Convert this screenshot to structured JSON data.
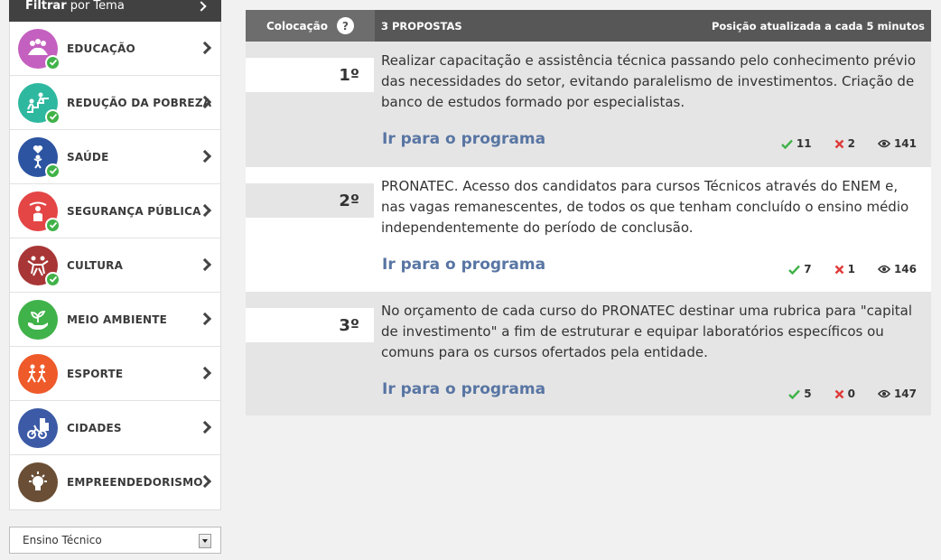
{
  "filter": {
    "title": "Filtrar",
    "subtitle": "por Tema"
  },
  "sidebar": {
    "items": [
      {
        "label": "EDUCAÇÃO",
        "color": "#c460bf",
        "checked": true
      },
      {
        "label": "REDUÇÃO DA POBREZA",
        "color": "#2fb8a0",
        "checked": true
      },
      {
        "label": "SAÚDE",
        "color": "#2c54a1",
        "checked": true
      },
      {
        "label": "SEGURANÇA PÚBLICA",
        "color": "#e44545",
        "checked": true
      },
      {
        "label": "CULTURA",
        "color": "#a83636",
        "checked": true
      },
      {
        "label": "MEIO AMBIENTE",
        "color": "#40b24a",
        "checked": false
      },
      {
        "label": "ESPORTE",
        "color": "#ef5a2a",
        "checked": false
      },
      {
        "label": "CIDADES",
        "color": "#3c5aa6",
        "checked": false
      },
      {
        "label": "EMPREENDEDORISMO",
        "color": "#6a4e35",
        "checked": false
      }
    ]
  },
  "select": {
    "value": "Ensino Técnico"
  },
  "table": {
    "col_rank": "Colocação",
    "help": "?",
    "count_label": "3 PROPOSTAS",
    "update_label": "Posição atualizada a cada 5 minutos"
  },
  "proposals": [
    {
      "rank": "1º",
      "text": "Realizar capacitação e assistência técnica passando pelo conhecimento prévio das necessidades do setor, evitando paralelismo de investimentos. Criação de banco de estudos formado por especialistas.",
      "link": "Ir para o programa",
      "likes": "11",
      "dislikes": "2",
      "views": "141"
    },
    {
      "rank": "2º",
      "text": "PRONATEC. Acesso dos candidatos para cursos Técnicos através do ENEM e, nas vagas remanescentes, de todos os que tenham concluído o ensino médio independentemente do período de conclusão.",
      "link": "Ir para o programa",
      "likes": "7",
      "dislikes": "1",
      "views": "146"
    },
    {
      "rank": "3º",
      "text": "No orçamento de cada curso do PRONATEC destinar uma rubrica para \"capital de investimento\" a fim de estruturar e equipar laboratórios específicos ou comuns para os cursos ofertados pela entidade.",
      "link": "Ir para o programa",
      "likes": "5",
      "dislikes": "0",
      "views": "147"
    }
  ],
  "colors": {
    "like": "#40b248",
    "dislike": "#e03a3a",
    "link": "#5875a3",
    "header": "#575757"
  }
}
